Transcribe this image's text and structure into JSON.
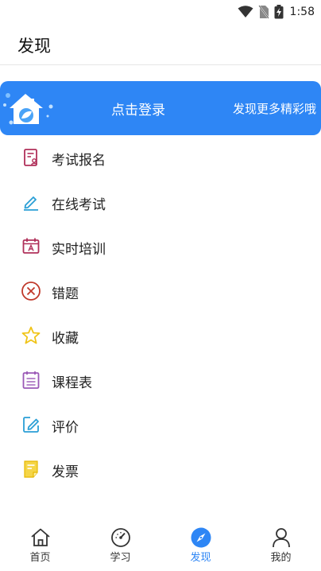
{
  "status_bar": {
    "time": "1:58",
    "icons": [
      "wifi-icon",
      "no-sim-icon",
      "battery-charging-icon"
    ]
  },
  "header": {
    "title": "发现"
  },
  "banner": {
    "login_label": "点击登录",
    "slogan": "发现更多精彩哦",
    "logo_icon": "house-leaf-icon"
  },
  "menu": {
    "items": [
      {
        "label": "考试报名",
        "icon": "exam-registration-icon"
      },
      {
        "label": "在线考试",
        "icon": "pen-icon"
      },
      {
        "label": "实时培训",
        "icon": "calendar-a-icon"
      },
      {
        "label": "错题",
        "icon": "wrong-circle-icon"
      },
      {
        "label": "收藏",
        "icon": "star-icon"
      },
      {
        "label": "课程表",
        "icon": "schedule-icon"
      },
      {
        "label": "评价",
        "icon": "edit-icon"
      },
      {
        "label": "发票",
        "icon": "invoice-icon"
      }
    ]
  },
  "tabbar": {
    "tabs": [
      {
        "label": "首页",
        "icon": "home-icon",
        "active": false
      },
      {
        "label": "学习",
        "icon": "gauge-icon",
        "active": false
      },
      {
        "label": "发现",
        "icon": "compass-icon",
        "active": true
      },
      {
        "label": "我的",
        "icon": "person-icon",
        "active": false
      }
    ]
  },
  "colors": {
    "accent": "#2e86f5",
    "banner_bg": "#2e86f5",
    "icon_red": "#c0392b",
    "icon_teal": "#2a9fd6",
    "icon_magenta": "#b0305a",
    "icon_yellow": "#f0c419",
    "icon_purple": "#9b59b6"
  }
}
